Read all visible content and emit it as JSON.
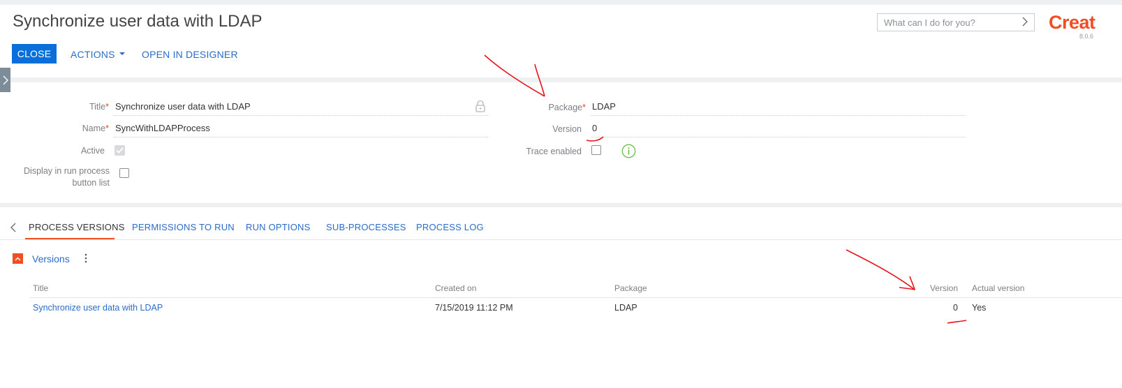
{
  "header": {
    "title": "Synchronize user data with LDAP",
    "search_placeholder": "What can I do for you?",
    "logo_text": "Creat",
    "version": "8.0.6"
  },
  "toolbar": {
    "close_label": "CLOSE",
    "actions_label": "ACTIONS",
    "open_designer_label": "OPEN IN DESIGNER"
  },
  "form": {
    "title_label": "Title",
    "title_value": "Synchronize user data with LDAP",
    "name_label": "Name",
    "name_value": "SyncWithLDAPProcess",
    "active_label": "Active",
    "display_label_line1": "Display in run process",
    "display_label_line2": "button list",
    "package_label": "Package",
    "package_value": "LDAP",
    "version_label": "Version",
    "version_value": "0",
    "trace_label": "Trace enabled"
  },
  "tabs": [
    {
      "label": "PROCESS VERSIONS",
      "active": true
    },
    {
      "label": "PERMISSIONS TO RUN",
      "active": false
    },
    {
      "label": "RUN OPTIONS",
      "active": false
    },
    {
      "label": "SUB-PROCESSES",
      "active": false
    },
    {
      "label": "PROCESS LOG",
      "active": false
    }
  ],
  "versions": {
    "group_title": "Versions",
    "columns": [
      "Title",
      "Created on",
      "Package",
      "Version",
      "Actual version"
    ],
    "rows": [
      {
        "title": "Synchronize user data with LDAP",
        "created_on": "7/15/2019 11:12 PM",
        "package": "LDAP",
        "version": "0",
        "actual_version": "Yes"
      }
    ]
  },
  "colors": {
    "accent": "#0a6fd8",
    "brand": "#f04e23",
    "link": "#2a6cc8",
    "annotation": "#e8141a"
  }
}
